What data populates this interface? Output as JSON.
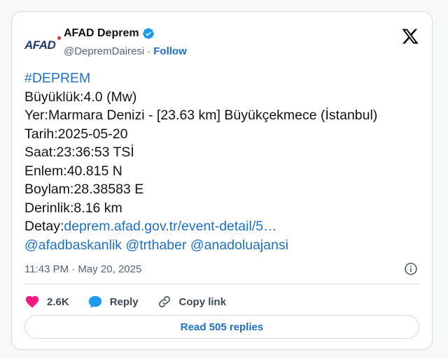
{
  "author": {
    "logo_text": "AFAD",
    "display_name": "AFAD Deprem",
    "handle": "@DepremDairesi",
    "separator": "·",
    "follow_label": "Follow"
  },
  "tweet": {
    "hashtag": "#DEPREM",
    "lines": [
      "Büyüklük:4.0 (Mw)",
      "Yer:Marmara Denizi - [23.63 km] Büyükçekmece (İstanbul)",
      "Tarih:2025-05-20",
      "Saat:23:36:53 TSİ",
      "Enlem:40.815 N",
      "Boylam:28.38583 E",
      "Derinlik:8.16 km"
    ],
    "detail_label": "Detay:",
    "detail_link": "deprem.afad.gov.tr/event-detail/5…",
    "mentions": [
      "@afadbaskanlik",
      "@trthaber",
      "@anadoluajansi"
    ]
  },
  "meta": {
    "timestamp": "11:43 PM · May 20, 2025"
  },
  "actions": {
    "like_count": "2.6K",
    "reply_label": "Reply",
    "copy_label": "Copy link"
  },
  "read_replies_label": "Read 505 replies",
  "colors": {
    "link": "#1d70c8",
    "like": "#f91880",
    "verified": "#1d9bf0"
  }
}
